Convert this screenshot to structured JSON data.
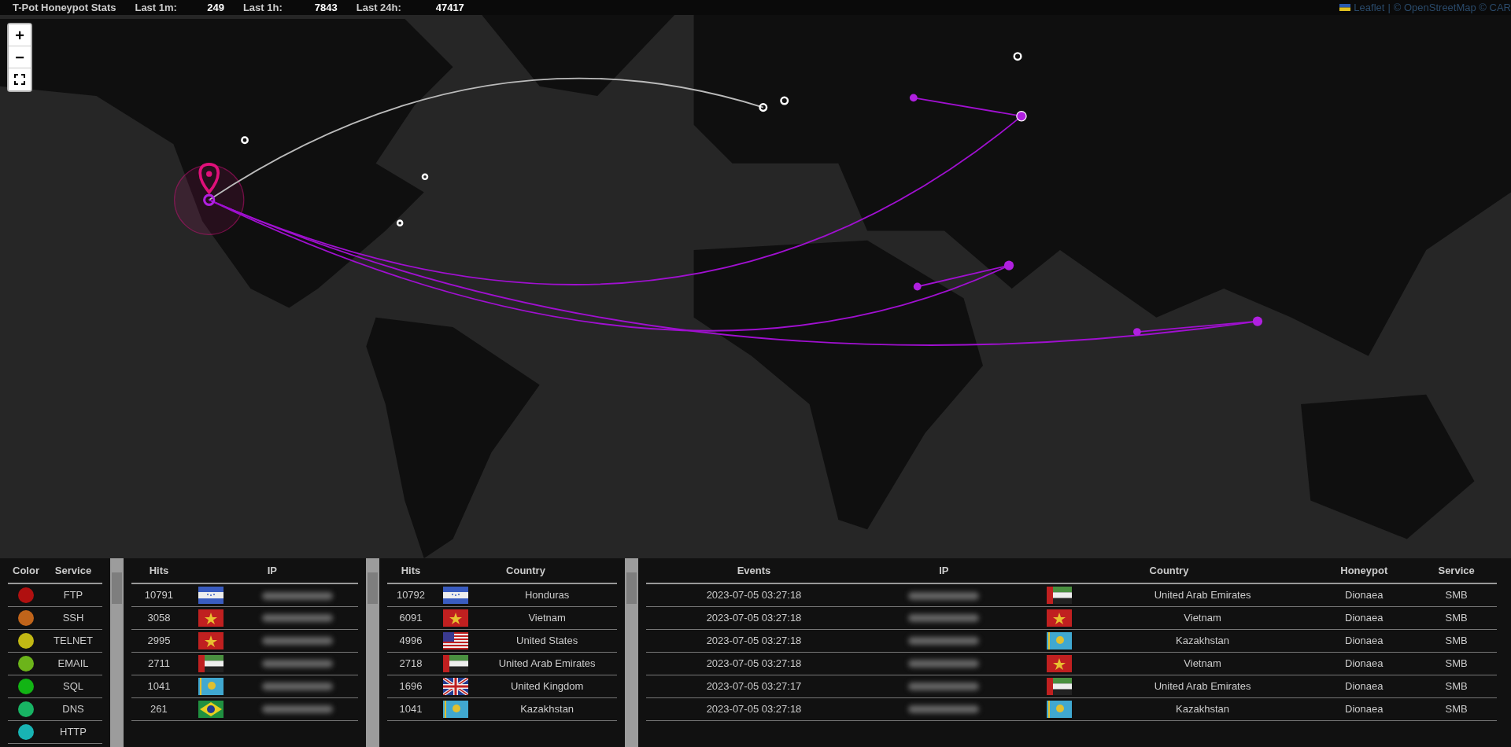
{
  "header": {
    "title": "T-Pot Honeypot Stats",
    "stats": [
      {
        "label": "Last 1m:",
        "value": "249"
      },
      {
        "label": "Last 1h:",
        "value": "7843"
      },
      {
        "label": "Last 24h:",
        "value": "47417"
      }
    ]
  },
  "map": {
    "zoom_controls": [
      "+",
      "−"
    ],
    "attribution": {
      "link": "Leaflet",
      "separator": "|",
      "credits": "© OpenStreetMap © CAR"
    }
  },
  "services": {
    "columns": [
      "Color",
      "Service"
    ],
    "rows": [
      {
        "service": "FTP",
        "color": "#b01010"
      },
      {
        "service": "SSH",
        "color": "#c0641a"
      },
      {
        "service": "TELNET",
        "color": "#c2b814"
      },
      {
        "service": "EMAIL",
        "color": "#6cb41a"
      },
      {
        "service": "SQL",
        "color": "#12b414"
      },
      {
        "service": "DNS",
        "color": "#18b464"
      },
      {
        "service": "HTTP",
        "color": "#18b4b4"
      }
    ]
  },
  "top_ips": {
    "columns": [
      "Hits",
      "IP"
    ],
    "rows": [
      {
        "hits": "10791",
        "kind": "hn"
      },
      {
        "hits": "3058",
        "kind": "vn"
      },
      {
        "hits": "2995",
        "kind": "vn"
      },
      {
        "hits": "2711",
        "kind": "ae"
      },
      {
        "hits": "1041",
        "kind": "kz"
      },
      {
        "hits": "261",
        "kind": "br"
      }
    ]
  },
  "top_countries": {
    "columns": [
      "Hits",
      "Country"
    ],
    "rows": [
      {
        "hits": "10792",
        "kind": "hn",
        "country": "Honduras"
      },
      {
        "hits": "6091",
        "kind": "vn",
        "country": "Vietnam"
      },
      {
        "hits": "4996",
        "kind": "us",
        "country": "United States"
      },
      {
        "hits": "2718",
        "kind": "ae",
        "country": "United Arab Emirates"
      },
      {
        "hits": "1696",
        "kind": "gb",
        "country": "United Kingdom"
      },
      {
        "hits": "1041",
        "kind": "kz",
        "country": "Kazakhstan"
      }
    ]
  },
  "events": {
    "columns": [
      "Events",
      "IP",
      "Country",
      "Honeypot",
      "Service"
    ],
    "rows": [
      {
        "time": "2023-07-05 03:27:18",
        "kind": "ae",
        "country": "United Arab Emirates",
        "honeypot": "Dionaea",
        "service": "SMB"
      },
      {
        "time": "2023-07-05 03:27:18",
        "kind": "vn",
        "country": "Vietnam",
        "honeypot": "Dionaea",
        "service": "SMB"
      },
      {
        "time": "2023-07-05 03:27:18",
        "kind": "kz",
        "country": "Kazakhstan",
        "honeypot": "Dionaea",
        "service": "SMB"
      },
      {
        "time": "2023-07-05 03:27:18",
        "kind": "vn",
        "country": "Vietnam",
        "honeypot": "Dionaea",
        "service": "SMB"
      },
      {
        "time": "2023-07-05 03:27:17",
        "kind": "ae",
        "country": "United Arab Emirates",
        "honeypot": "Dionaea",
        "service": "SMB"
      },
      {
        "time": "2023-07-05 03:27:18",
        "kind": "kz",
        "country": "Kazakhstan",
        "honeypot": "Dionaea",
        "service": "SMB"
      }
    ]
  }
}
